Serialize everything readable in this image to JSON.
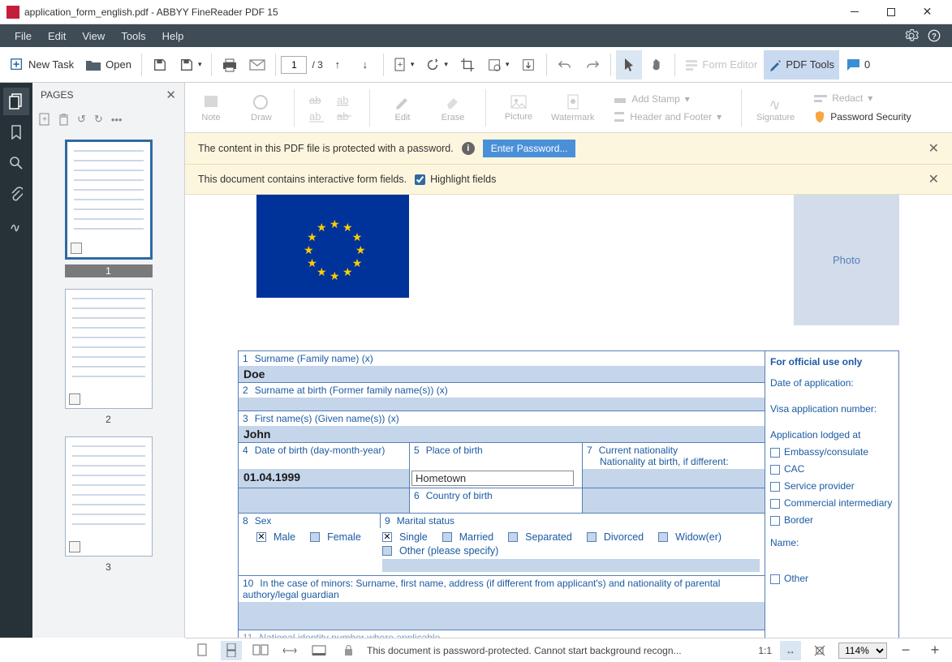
{
  "window": {
    "title": "application_form_english.pdf - ABBYY FineReader PDF 15"
  },
  "menu": {
    "file": "File",
    "edit": "Edit",
    "view": "View",
    "tools": "Tools",
    "help": "Help"
  },
  "toolbar": {
    "new_task": "New Task",
    "open": "Open",
    "page_current": "1",
    "page_total": "/ 3",
    "form_editor": "Form Editor",
    "pdf_tools": "PDF Tools",
    "comments_count": "0"
  },
  "pages_panel": {
    "title": "PAGES",
    "thumbs": [
      {
        "num": "1",
        "selected": true
      },
      {
        "num": "2",
        "selected": false
      },
      {
        "num": "3",
        "selected": false
      }
    ]
  },
  "ribbon": {
    "note": "Note",
    "draw": "Draw",
    "edit": "Edit",
    "erase": "Erase",
    "picture": "Picture",
    "watermark": "Watermark",
    "add_stamp": "Add Stamp",
    "header_footer": "Header and Footer",
    "signature": "Signature",
    "redact": "Redact",
    "password": "Password Security"
  },
  "banners": {
    "protected": "The content in this PDF file is protected with a password.",
    "enter_password": "Enter Password...",
    "interactive": "This document contains interactive form fields.",
    "highlight": "Highlight fields"
  },
  "document": {
    "photo": "Photo",
    "fields": {
      "f1_label": "Surname (Family name) (x)",
      "f1_val": "Doe",
      "f2_label": "Surname at birth (Former family name(s)) (x)",
      "f3_label": "First name(s) (Given name(s)) (x)",
      "f3_val": "John",
      "f4_label": "Date of birth (day-month-year)",
      "f4_val": "01.04.1999",
      "f5_label": "Place of birth",
      "f5_val": "Hometown",
      "f6_label": "Country of birth",
      "f7_label": "Current nationality",
      "f7_sub": "Nationality at birth, if different:",
      "f8_label": "Sex",
      "f8_male": "Male",
      "f8_female": "Female",
      "f9_label": "Marital status",
      "f9_single": "Single",
      "f9_married": "Married",
      "f9_separated": "Separated",
      "f9_divorced": "Divorced",
      "f9_widow": "Widow(er)",
      "f9_other": "Other (please specify)",
      "f10_label": "In the case of minors: Surname, first name, address (if different from applicant's) and nationality of parental authory/legal guardian",
      "f11_label": "National identity number where applicable"
    },
    "official": {
      "title": "For official use only",
      "date_app": "Date of application:",
      "visa_num": "Visa application number:",
      "lodged_at": "Application lodged at",
      "embassy": "Embassy/consulate",
      "cac": "CAC",
      "service": "Service provider",
      "commercial": "Commercial intermediary",
      "border": "Border",
      "name": "Name:",
      "other": "Other"
    }
  },
  "statusbar": {
    "msg": "This document is password-protected. Cannot start background recogn...",
    "ratio": "1:1",
    "zoom": "114%"
  }
}
